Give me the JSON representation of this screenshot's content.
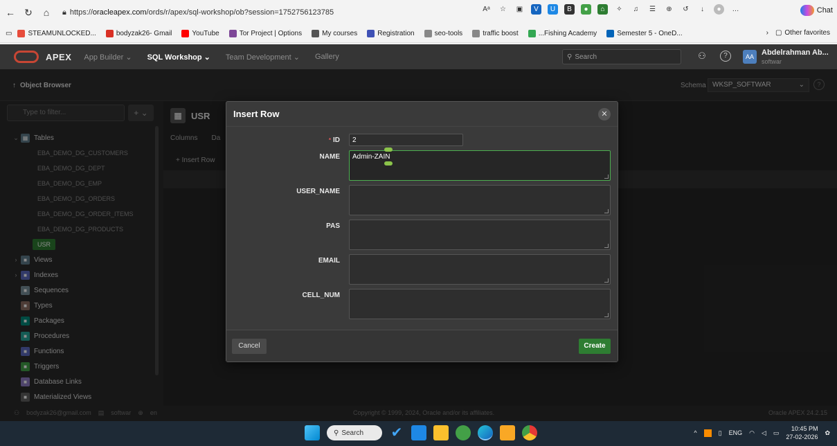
{
  "browser": {
    "url_prefix": "https://",
    "url_host": "oracleapex.com",
    "url_path": "/ords/r/apex/sql-workshop/ob?session=1752756123785",
    "chat_label": "Chat",
    "favorites": [
      {
        "label": "STEAMUNLOCKED...",
        "color": "#e74c3c"
      },
      {
        "label": "bodyzak26- Gmail",
        "color": "#d93025"
      },
      {
        "label": "YouTube",
        "color": "#ff0000"
      },
      {
        "label": "Tor Project | Options",
        "color": "#7e4798"
      },
      {
        "label": "My courses",
        "color": "#555555"
      },
      {
        "label": "Registration",
        "color": "#3f51b5"
      },
      {
        "label": "seo-tools",
        "color": "#888888"
      },
      {
        "label": "traffic boost",
        "color": "#888888"
      },
      {
        "label": "...Fishing Academy",
        "color": "#34a853"
      },
      {
        "label": "Semester 5 - OneD...",
        "color": "#0364b8"
      }
    ],
    "other_favorites": "Other favorites"
  },
  "apex": {
    "logo_text": "APEX",
    "menu": [
      {
        "label": "App Builder ⌄",
        "active": false
      },
      {
        "label": "SQL Workshop ⌄",
        "active": true
      },
      {
        "label": "Team Development ⌄",
        "active": false
      },
      {
        "label": "Gallery",
        "active": false
      }
    ],
    "search_placeholder": "Search",
    "avatar_initials": "AA",
    "user_name": "Abdelrahman Ab...",
    "user_workspace": "softwar"
  },
  "object_browser": {
    "title": "Object Browser",
    "schema_label": "Schema",
    "schema_value": "WKSP_SOFTWAR"
  },
  "sidebar": {
    "filter_placeholder": "Type to filter...",
    "add_label": "+ ⌄",
    "tables_label": "Tables",
    "tables": [
      "EBA_DEMO_DG_CUSTOMERS",
      "EBA_DEMO_DG_DEPT",
      "EBA_DEMO_DG_EMP",
      "EBA_DEMO_DG_ORDERS",
      "EBA_DEMO_DG_ORDER_ITEMS",
      "EBA_DEMO_DG_PRODUCTS"
    ],
    "selected_table": "USR",
    "categories": [
      {
        "label": "Views",
        "color": "#607d8b",
        "expandable": true
      },
      {
        "label": "Indexes",
        "color": "#5c6bc0",
        "expandable": true
      },
      {
        "label": "Sequences",
        "color": "#78909c",
        "expandable": false
      },
      {
        "label": "Types",
        "color": "#8d6e63",
        "expandable": false
      },
      {
        "label": "Packages",
        "color": "#00897b",
        "expandable": false
      },
      {
        "label": "Procedures",
        "color": "#26a69a",
        "expandable": false
      },
      {
        "label": "Functions",
        "color": "#5c6bc0",
        "expandable": false
      },
      {
        "label": "Triggers",
        "color": "#43a047",
        "expandable": false
      },
      {
        "label": "Database Links",
        "color": "#8e7cc3",
        "expandable": false
      },
      {
        "label": "Materialized Views",
        "color": "#616161",
        "expandable": false
      }
    ]
  },
  "status": {
    "email": "bodyzak26@gmail.com",
    "workspace": "softwar",
    "lang": "en",
    "copyright": "Copyright © 1999, 2024, Oracle and/or its affiliates.",
    "version": "Oracle APEX 24.2.15"
  },
  "main": {
    "table_name": "USR",
    "tabs": [
      "Columns",
      "Da"
    ],
    "insert_label": "+ Insert Row"
  },
  "dialog": {
    "title": "Insert Row",
    "fields": [
      {
        "label": "ID",
        "value": "2",
        "required": true
      },
      {
        "label": "NAME",
        "value": "Admin-ZAIN",
        "required": false
      },
      {
        "label": "USER_NAME",
        "value": "",
        "required": false
      },
      {
        "label": "PAS",
        "value": "",
        "required": false
      },
      {
        "label": "EMAIL",
        "value": "",
        "required": false
      },
      {
        "label": "CELL_NUM",
        "value": "",
        "required": false
      }
    ],
    "cancel_label": "Cancel",
    "create_label": "Create"
  },
  "taskbar": {
    "search_label": "Search",
    "lang": "ENG",
    "time": "10:45 PM",
    "date": "27-02-2026"
  }
}
